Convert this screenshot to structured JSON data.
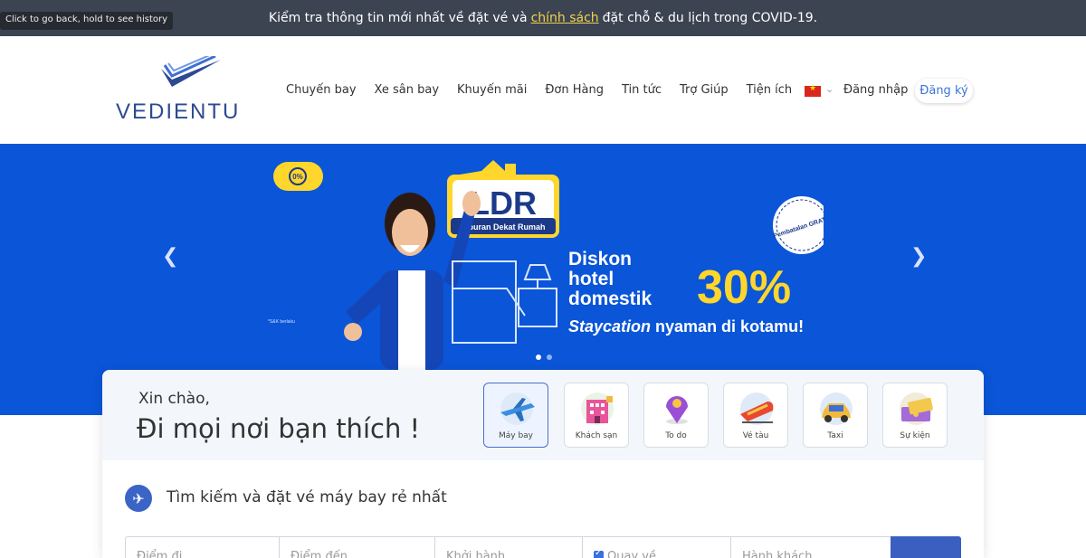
{
  "topbar": {
    "text_before": "Kiểm tra thông tin mới nhất về đặt vé và",
    "link": "chính sách",
    "text_after": "đặt chỗ & du lịch trong COVID-19."
  },
  "tooltip": "Click to go back, hold to see history",
  "header": {
    "logo_text": "VEDIENTU",
    "nav": [
      "Chuyến bay",
      "Xe sân bay",
      "Khuyến mãi",
      "Đơn Hàng",
      "Tin tức",
      "Trợ Giúp",
      "Tiện ích"
    ],
    "login": "Đăng nhập",
    "register": "Đăng ký"
  },
  "banner": {
    "badge": "0%",
    "brand": "LDR",
    "brand_sub": "Liburan Dekat Rumah",
    "stamp": "Pembatalan GRATIS",
    "line1": "Diskon",
    "line2": "hotel",
    "line3": "domestik",
    "discount": "30%",
    "tagline_em": "Staycation",
    "tagline": " nyaman di kotamu!",
    "fineprint": "*S&K berlaku",
    "slides": 2,
    "active_slide": 1
  },
  "panel": {
    "greeting": "Xin chào,",
    "slogan": "Đi mọi nơi bạn thích !",
    "services": [
      {
        "label": "Máy bay",
        "icon": "airplane-icon"
      },
      {
        "label": "Khách sạn",
        "icon": "hotel-icon"
      },
      {
        "label": "To do",
        "icon": "map-pin-icon"
      },
      {
        "label": "Vé tàu",
        "icon": "train-icon"
      },
      {
        "label": "Taxi",
        "icon": "taxi-icon"
      },
      {
        "label": "Sự kiện",
        "icon": "ticket-icon"
      }
    ],
    "search_title": "Tìm kiếm và đặt vé máy bay rẻ nhất",
    "fields": {
      "from": "Điểm đi",
      "to": "Điểm đến",
      "depart": "Khởi hành",
      "return": "Quay về",
      "passengers": "Hành khách"
    }
  },
  "colors": {
    "topbar": "#3c4452",
    "hero": "#0a55d8",
    "brand": "#2d4a91",
    "accent": "#3a5fc1",
    "highlight": "#f3d34a"
  }
}
